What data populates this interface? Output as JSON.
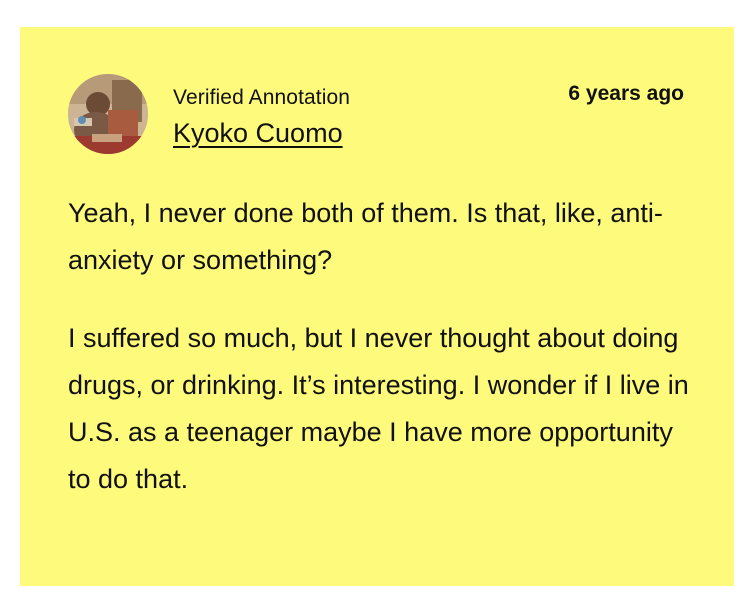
{
  "annotation": {
    "verified_label": "Verified Annotation",
    "author_name": "Kyoko Cuomo",
    "timestamp": "6 years ago",
    "paragraphs": [
      "Yeah, I never done both of them. Is that, like, anti-anxiety or something?",
      "I suffered so much, but I never thought about doing drugs, or drinking. It’s interesting. I wonder if I live in U.S. as a teenager maybe I have more opportunity to do that."
    ]
  },
  "colors": {
    "card_background": "#fdfa7c",
    "text": "#111111",
    "page_background": "#ffffff"
  },
  "icons": {
    "avatar": "user-avatar-photo",
    "pointer": "speech-pointer"
  }
}
